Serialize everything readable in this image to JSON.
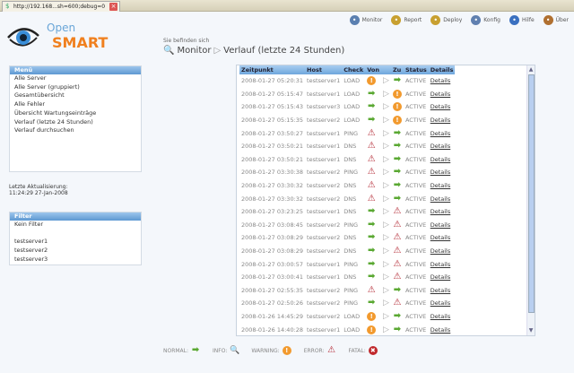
{
  "browser": {
    "tab_title": "http://192.168...sh=600;debug=0"
  },
  "logo": {
    "open": "Open",
    "smart": "SMART"
  },
  "topnav": [
    {
      "label": "Monitor",
      "icon": "search-icon",
      "color": "#5a7fb0"
    },
    {
      "label": "Report",
      "icon": "sigma-icon",
      "color": "#c8a030"
    },
    {
      "label": "Deploy",
      "icon": "info-doc-icon",
      "color": "#c8a030"
    },
    {
      "label": "Konfig",
      "icon": "gear-icon",
      "color": "#6080b0"
    },
    {
      "label": "Hilfe",
      "icon": "help-icon",
      "color": "#3a70c0"
    },
    {
      "label": "Über",
      "icon": "users-icon",
      "color": "#b07030"
    }
  ],
  "breadcrumb": {
    "prefix": "Sie befinden sich",
    "root": "Monitor",
    "current": "Verlauf (letzte 24 Stunden)"
  },
  "menu": {
    "title": "Menü",
    "items": [
      "Alle Server",
      "Alle Server (gruppiert)",
      "Gesamtübersicht",
      "Alle Fehler",
      "Übersicht Wartungseinträge",
      "Verlauf (letzte 24 Stunden)",
      "Verlauf durchsuchen"
    ]
  },
  "last_update": {
    "label": "Letzte Aktualisierung:",
    "value": "11:24:29 27-Jan-2008"
  },
  "filter": {
    "title": "Filter",
    "items": [
      "Kein Filter",
      "",
      "testserver1",
      "testserver2",
      "testserver3"
    ]
  },
  "table": {
    "headers": [
      "Zeitpunkt",
      "Host",
      "Check",
      "Von",
      "",
      "Zu",
      "Status",
      "Details"
    ],
    "rows": [
      [
        "2008-01-27 05:20:31",
        "testserver1",
        "LOAD",
        "warning",
        "normal",
        "ACTIVE",
        "Details"
      ],
      [
        "2008-01-27 05:15:47",
        "testserver1",
        "LOAD",
        "normal",
        "warning",
        "ACTIVE",
        "Details"
      ],
      [
        "2008-01-27 05:15:43",
        "testserver3",
        "LOAD",
        "normal",
        "warning",
        "ACTIVE",
        "Details"
      ],
      [
        "2008-01-27 05:15:35",
        "testserver2",
        "LOAD",
        "normal",
        "warning",
        "ACTIVE",
        "Details"
      ],
      [
        "2008-01-27 03:50:27",
        "testserver1",
        "PING",
        "error",
        "normal",
        "ACTIVE",
        "Details"
      ],
      [
        "2008-01-27 03:50:21",
        "testserver1",
        "DNS",
        "error",
        "normal",
        "ACTIVE",
        "Details"
      ],
      [
        "2008-01-27 03:50:21",
        "testserver1",
        "DNS",
        "error",
        "normal",
        "ACTIVE",
        "Details"
      ],
      [
        "2008-01-27 03:30:38",
        "testserver2",
        "PING",
        "error",
        "normal",
        "ACTIVE",
        "Details"
      ],
      [
        "2008-01-27 03:30:32",
        "testserver2",
        "DNS",
        "error",
        "normal",
        "ACTIVE",
        "Details"
      ],
      [
        "2008-01-27 03:30:32",
        "testserver2",
        "DNS",
        "error",
        "normal",
        "ACTIVE",
        "Details"
      ],
      [
        "2008-01-27 03:23:25",
        "testserver1",
        "DNS",
        "normal",
        "error",
        "ACTIVE",
        "Details"
      ],
      [
        "2008-01-27 03:08:45",
        "testserver2",
        "PING",
        "normal",
        "error",
        "ACTIVE",
        "Details"
      ],
      [
        "2008-01-27 03:08:29",
        "testserver2",
        "DNS",
        "normal",
        "error",
        "ACTIVE",
        "Details"
      ],
      [
        "2008-01-27 03:08:29",
        "testserver2",
        "DNS",
        "normal",
        "error",
        "ACTIVE",
        "Details"
      ],
      [
        "2008-01-27 03:00:57",
        "testserver1",
        "PING",
        "normal",
        "error",
        "ACTIVE",
        "Details"
      ],
      [
        "2008-01-27 03:00:41",
        "testserver1",
        "DNS",
        "normal",
        "error",
        "ACTIVE",
        "Details"
      ],
      [
        "2008-01-27 02:55:35",
        "testserver2",
        "PING",
        "error",
        "normal",
        "ACTIVE",
        "Details"
      ],
      [
        "2008-01-27 02:50:26",
        "testserver2",
        "PING",
        "normal",
        "error",
        "ACTIVE",
        "Details"
      ],
      [
        "2008-01-26 14:45:29",
        "testserver2",
        "LOAD",
        "warning",
        "normal",
        "ACTIVE",
        "Details"
      ],
      [
        "2008-01-26 14:40:28",
        "testserver1",
        "LOAD",
        "warning",
        "normal",
        "ACTIVE",
        "Details"
      ]
    ]
  },
  "legend": [
    {
      "label": "NORMAL:",
      "state": "normal"
    },
    {
      "label": "INFO:",
      "state": "info"
    },
    {
      "label": "WARNING:",
      "state": "warning"
    },
    {
      "label": "ERROR:",
      "state": "error"
    },
    {
      "label": "FATAL:",
      "state": "fatal"
    }
  ]
}
